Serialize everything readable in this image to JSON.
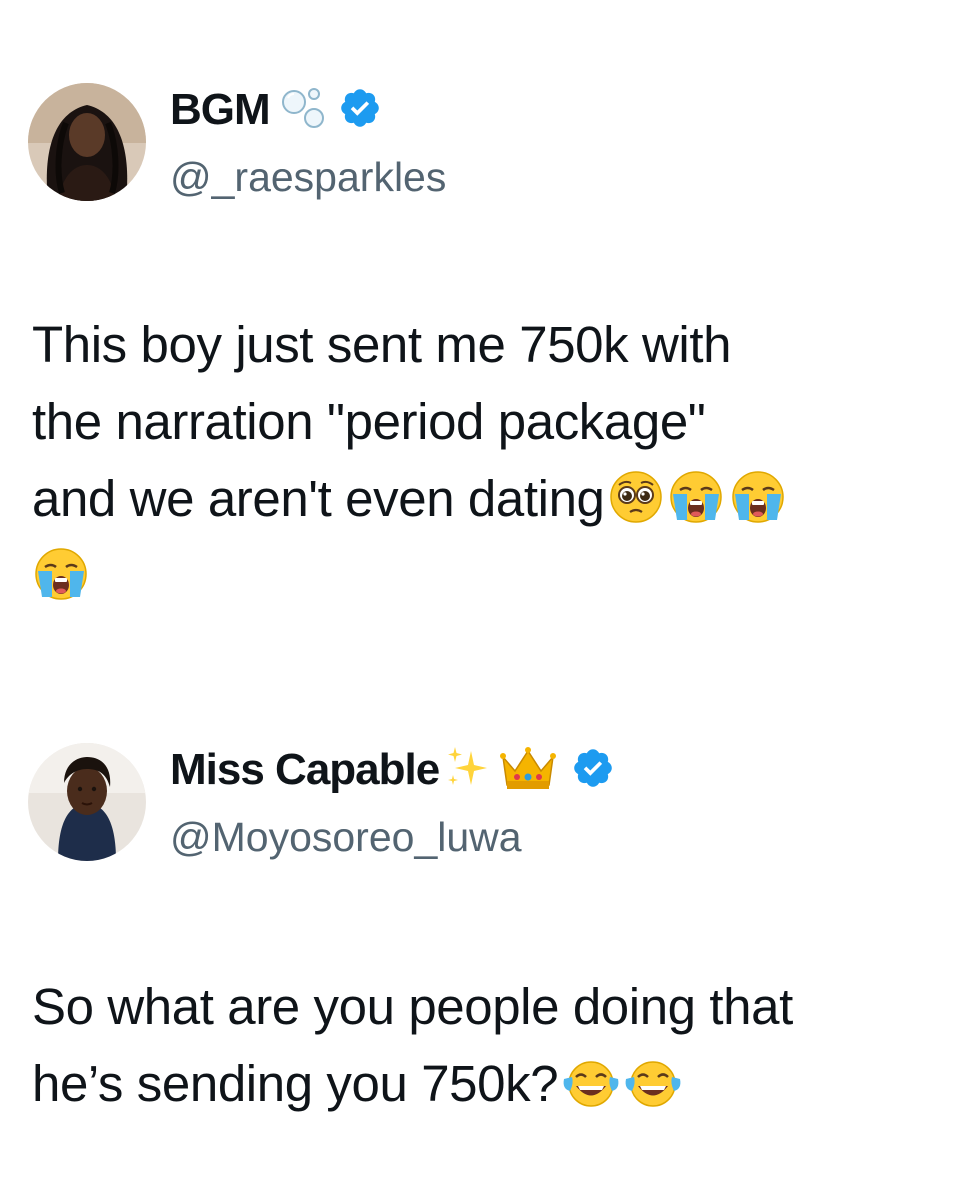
{
  "tweets": [
    {
      "display_name": "BGM",
      "name_decorations": [
        "bubbles-emoji"
      ],
      "verified": true,
      "handle": "@_raesparkles",
      "text_line_1": "This boy just sent me 750k with",
      "text_line_2": "the narration \"period package\"",
      "text_line_3": "and we aren't even dating",
      "trailing_emojis": [
        "pleading-face-emoji",
        "loudly-crying-face-emoji",
        "loudly-crying-face-emoji",
        "loudly-crying-face-emoji"
      ]
    },
    {
      "display_name": "Miss Capable",
      "name_decorations": [
        "sparkles-emoji",
        "crown-emoji"
      ],
      "verified": true,
      "handle": "@Moyosoreo_luwa",
      "text_line_1": "So what are you people doing that",
      "text_line_2": "he’s sending you 750k?",
      "trailing_emojis": [
        "face-with-tears-of-joy-emoji",
        "face-with-tears-of-joy-emoji"
      ]
    }
  ],
  "colors": {
    "text": "#0f1419",
    "handle": "#536471",
    "verified_badge": "#1d9bf0",
    "background": "#ffffff"
  }
}
